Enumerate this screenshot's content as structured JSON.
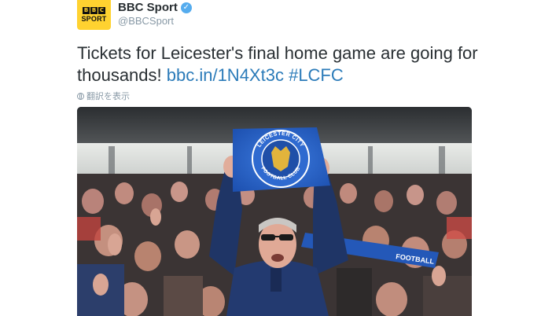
{
  "tweet": {
    "author_name": "BBC Sport",
    "author_handle": "@BBCSport",
    "verified_icon": "✓",
    "avatar": {
      "blocks": [
        "B",
        "B",
        "C"
      ],
      "word": "SPORT"
    },
    "text_plain": "Tickets for Leicester's final home game are going for thousands! ",
    "link": "bbc.in/1N4Xt3c",
    "hashtag": "#LCFC",
    "translate_label": "翻訳を表示"
  },
  "photo": {
    "flag_top_text": "LEICESTER CITY",
    "flag_bottom_text": "FOOTBALL CLUB",
    "scarf_text": "FOOTBALL"
  },
  "colors": {
    "link": "#2b7bb9",
    "avatar_bg": "#ffd230",
    "verified": "#55acee",
    "lcfc_blue": "#1f5bb8"
  }
}
